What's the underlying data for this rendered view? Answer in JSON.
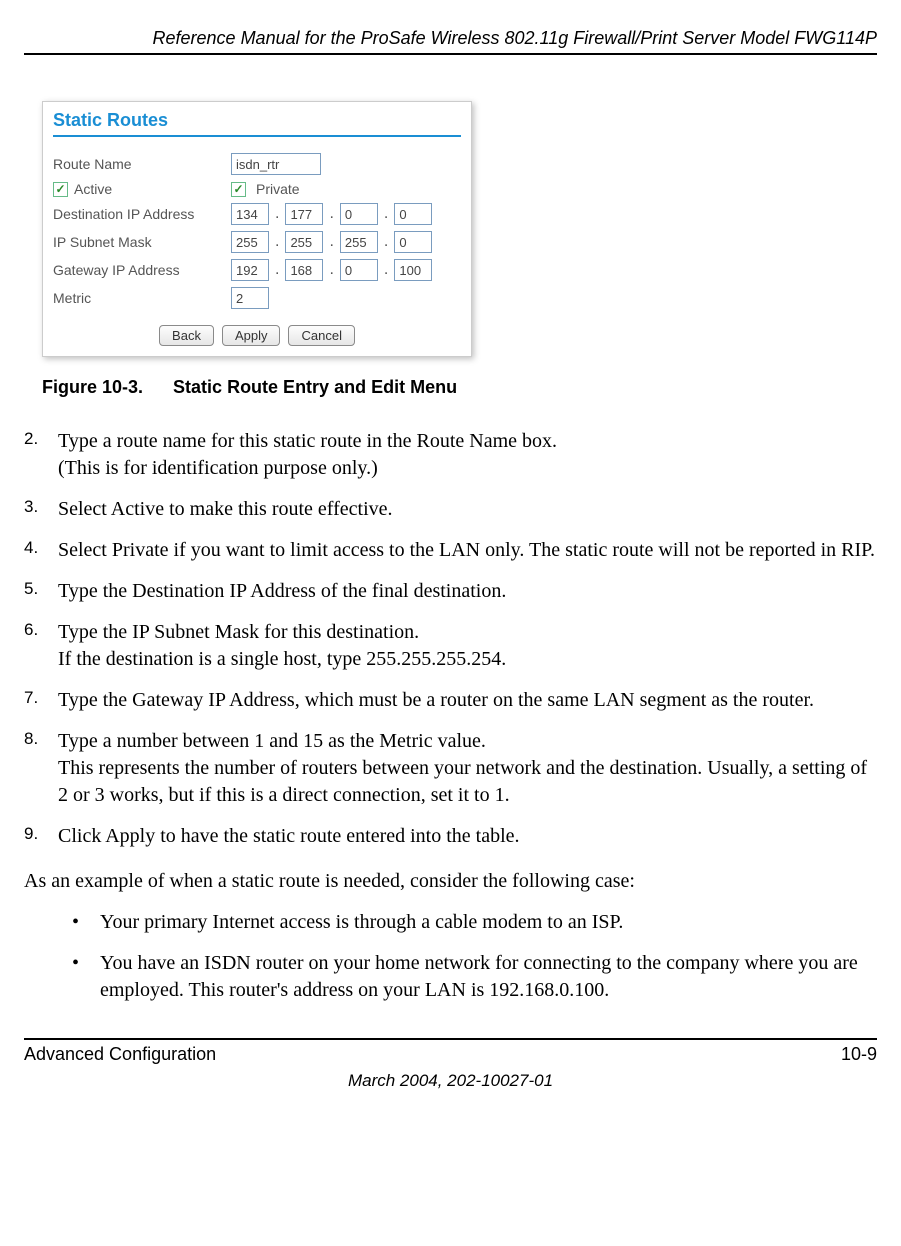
{
  "header": {
    "title": "Reference Manual for the ProSafe Wireless 802.11g  Firewall/Print Server Model FWG114P"
  },
  "figure": {
    "panel_title": "Static Routes",
    "labels": {
      "route_name": "Route Name",
      "active": "Active",
      "private": "Private",
      "dest_ip": "Destination IP Address",
      "subnet": "IP Subnet Mask",
      "gateway": "Gateway IP Address",
      "metric": "Metric"
    },
    "values": {
      "route_name": "isdn_rtr",
      "active_checked": "✓",
      "private_checked": "✓",
      "dest_ip": [
        "134",
        "177",
        "0",
        "0"
      ],
      "subnet": [
        "255",
        "255",
        "255",
        "0"
      ],
      "gateway": [
        "192",
        "168",
        "0",
        "100"
      ],
      "metric": "2"
    },
    "buttons": {
      "back": "Back",
      "apply": "Apply",
      "cancel": "Cancel"
    },
    "caption_label": "Figure 10-3.",
    "caption_text": "Static Route Entry and Edit Menu"
  },
  "steps": [
    "Type a route name for this static route in the Route Name box.\n(This is for identification purpose only.)",
    "Select Active to make this route effective.",
    "Select Private if you want to limit access to the LAN only. The static route will not be reported in RIP.",
    "Type the Destination IP Address of the final destination.",
    "Type the IP Subnet Mask for this destination.\nIf the destination is a single host, type 255.255.255.254.",
    "Type the Gateway IP Address, which must be a router on the same LAN segment as the router.",
    "Type a number between 1 and 15 as the Metric value.\nThis represents the number of routers between your network and the destination. Usually, a setting of 2 or 3 works, but if this is a direct connection, set it to 1.",
    "Click Apply to have the static route entered into the table."
  ],
  "step_start": 2,
  "intro": "As an example of when a static route is needed, consider the following case:",
  "bullets": [
    "Your primary Internet access is through a cable modem to an ISP.",
    "You have an ISDN router on your home network for connecting to the company where you are employed. This router's address on your LAN is 192.168.0.100."
  ],
  "footer": {
    "left": "Advanced Configuration",
    "right": "10-9",
    "date": "March 2004, 202-10027-01"
  }
}
